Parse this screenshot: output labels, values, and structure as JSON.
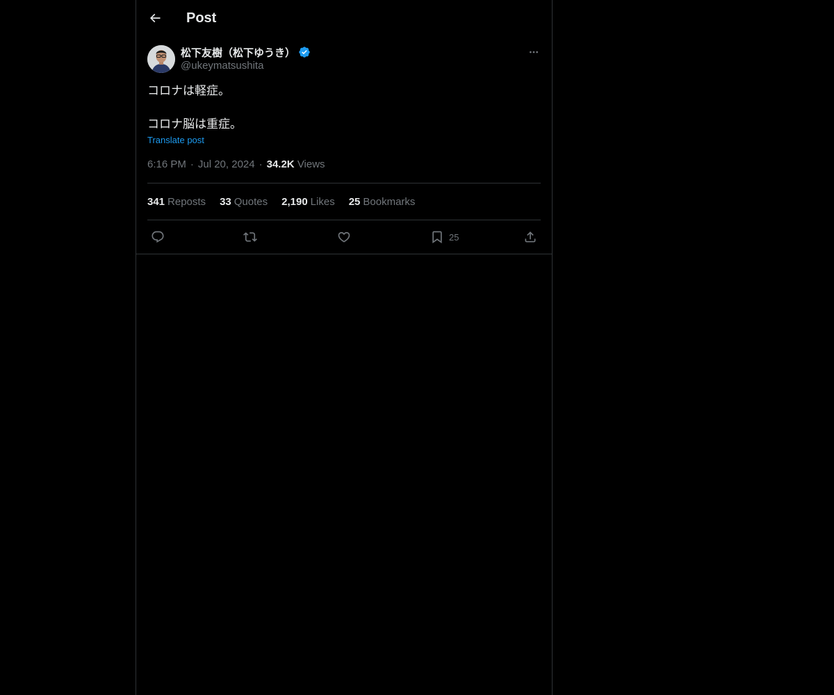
{
  "header": {
    "title": "Post"
  },
  "post": {
    "author": {
      "display_name": "松下友樹（松下ゆうき）",
      "handle": "@ukeymatsushita",
      "verified": true
    },
    "text_lines": [
      "コロナは軽症。",
      "コロナ脳は重症。"
    ],
    "translate_label": "Translate post",
    "time": "6:16 PM",
    "date": "Jul 20, 2024",
    "views_count": "34.2K",
    "views_label": "Views",
    "stats": [
      {
        "count": "341",
        "label": "Reposts"
      },
      {
        "count": "33",
        "label": "Quotes"
      },
      {
        "count": "2,190",
        "label": "Likes"
      },
      {
        "count": "25",
        "label": "Bookmarks"
      }
    ],
    "actions": {
      "bookmark_count": "25"
    }
  },
  "colors": {
    "background": "#000000",
    "text_primary": "#e7e9ea",
    "text_secondary": "#71767b",
    "accent": "#1d9bf0",
    "border": "#2f3336"
  },
  "icons": [
    "back-arrow-icon",
    "verified-badge-icon",
    "more-icon",
    "reply-icon",
    "repost-icon",
    "like-icon",
    "bookmark-icon",
    "share-icon"
  ]
}
